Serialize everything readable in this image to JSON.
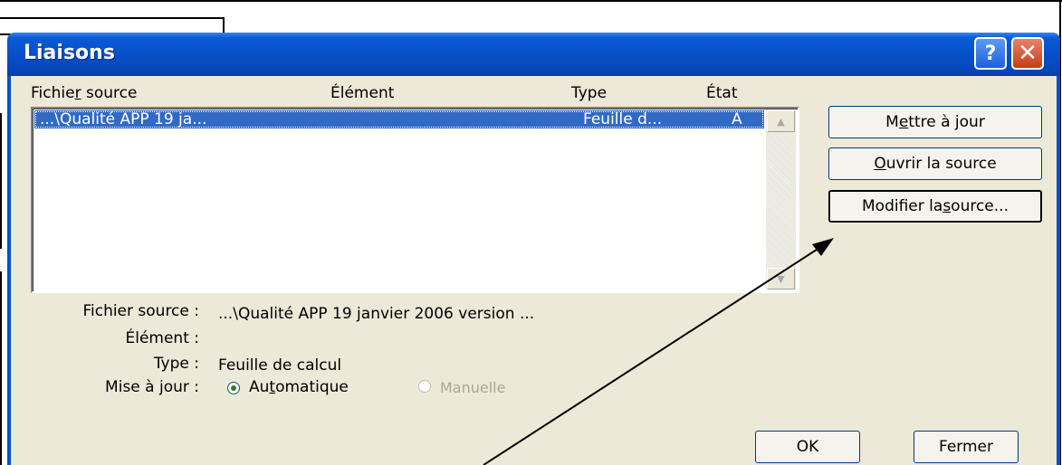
{
  "dialog": {
    "title": "Liaisons",
    "help_glyph": "?",
    "close_glyph": "✕"
  },
  "list": {
    "columns": {
      "source_pre": "Fichie",
      "source_u": "r",
      "source_post": " source",
      "element": "Élément",
      "type": "Type",
      "state": "État"
    },
    "rows": [
      {
        "source": "...\\Qualité APP 19 ja...",
        "element": "",
        "type": "Feuille d...",
        "state": "A"
      }
    ],
    "scroll_up_glyph": "▲",
    "scroll_down_glyph": "▼"
  },
  "buttons": {
    "update_pre": "M",
    "update_u": "e",
    "update_post": "ttre à jour",
    "open_u": "O",
    "open_post": "uvrir la source",
    "modify_pre": "Modifier la ",
    "modify_u": "s",
    "modify_post": "ource...",
    "ok": "OK",
    "close": "Fermer"
  },
  "details": {
    "source_label": "Fichier source :",
    "source_value": "...\\Qualité APP 19 janvier 2006 version ...",
    "element_label": "Élément :",
    "element_value": "",
    "type_label": "Type :",
    "type_value": "Feuille de calcul",
    "update_label": "Mise à jour :",
    "auto_pre": "Au",
    "auto_u": "t",
    "auto_post": "omatique",
    "auto_checked": true,
    "manual": "Manuelle",
    "manual_enabled": false
  },
  "colors": {
    "titlebar": "#0750c8",
    "selection": "#316ac5",
    "dialog_bg": "#ece9d8",
    "annotation_arrow": "#000000"
  }
}
